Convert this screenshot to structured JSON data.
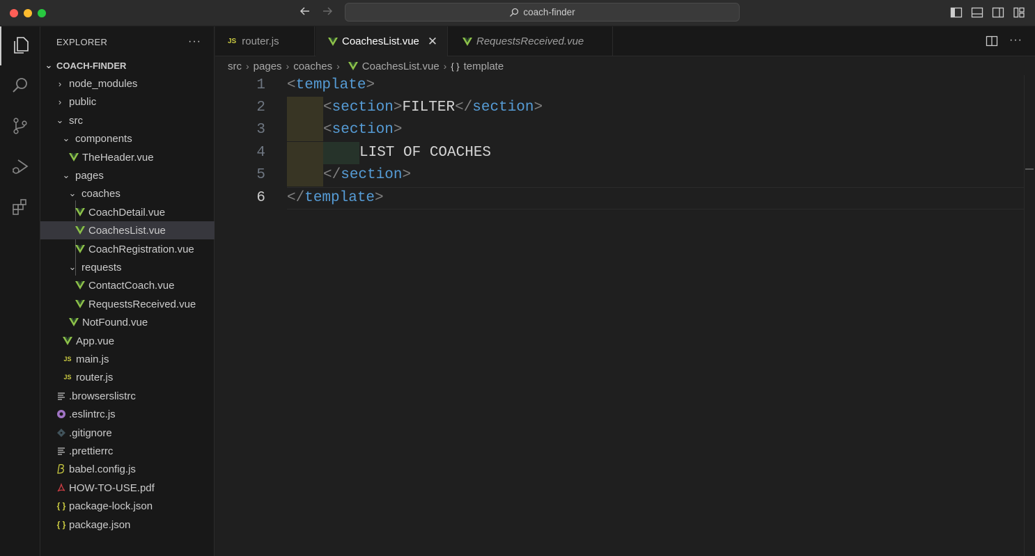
{
  "window": {
    "search_text": "coach-finder"
  },
  "sidebar": {
    "title": "EXPLORER",
    "more": "···",
    "tree": [
      {
        "label": "COACH-FINDER",
        "kind": "root"
      },
      {
        "label": "node_modules",
        "kind": "folder-collapsed"
      },
      {
        "label": "public",
        "kind": "folder-collapsed"
      },
      {
        "label": "src",
        "kind": "folder-open"
      },
      {
        "label": "components",
        "kind": "folder-open"
      },
      {
        "label": "TheHeader.vue",
        "kind": "vue"
      },
      {
        "label": "pages",
        "kind": "folder-open"
      },
      {
        "label": "coaches",
        "kind": "folder-open"
      },
      {
        "label": "CoachDetail.vue",
        "kind": "vue"
      },
      {
        "label": "CoachesList.vue",
        "kind": "vue",
        "selected": true
      },
      {
        "label": "CoachRegistration.vue",
        "kind": "vue"
      },
      {
        "label": "requests",
        "kind": "folder-open"
      },
      {
        "label": "ContactCoach.vue",
        "kind": "vue"
      },
      {
        "label": "RequestsReceived.vue",
        "kind": "vue"
      },
      {
        "label": "NotFound.vue",
        "kind": "vue"
      },
      {
        "label": "App.vue",
        "kind": "vue"
      },
      {
        "label": "main.js",
        "kind": "js"
      },
      {
        "label": "router.js",
        "kind": "js"
      },
      {
        "label": ".browserslistrc",
        "kind": "lines"
      },
      {
        "label": ".eslintrc.js",
        "kind": "eslint"
      },
      {
        "label": ".gitignore",
        "kind": "git"
      },
      {
        "label": ".prettierrc",
        "kind": "lines"
      },
      {
        "label": "babel.config.js",
        "kind": "babel"
      },
      {
        "label": "HOW-TO-USE.pdf",
        "kind": "pdf"
      },
      {
        "label": "package-lock.json",
        "kind": "json"
      },
      {
        "label": "package.json",
        "kind": "json"
      }
    ]
  },
  "icons": {
    "js_text": "JS",
    "json_text": "{ }"
  },
  "tabs": [
    {
      "label": "router.js",
      "kind": "js",
      "active": false
    },
    {
      "label": "CoachesList.vue",
      "kind": "vue",
      "active": true,
      "close": "✕"
    },
    {
      "label": "RequestsReceived.vue",
      "kind": "vue",
      "active": false,
      "italic": true
    }
  ],
  "breadcrumb": {
    "items": [
      "src",
      "pages",
      "coaches",
      "CoachesList.vue",
      "template"
    ],
    "symbol_glyph": "{ }"
  },
  "editor": {
    "line_numbers": [
      "1",
      "2",
      "3",
      "4",
      "5",
      "6"
    ],
    "current_line": "6",
    "lines": [
      {
        "open": "<",
        "name": "template",
        "close": ">"
      },
      {
        "open": "<",
        "name": "section",
        "close": ">",
        "text": "FILTER",
        "end_open": "</",
        "end_name": "section",
        "end_close": ">"
      },
      {
        "open": "<",
        "name": "section",
        "close": ">"
      },
      {
        "text": "LIST OF COACHES"
      },
      {
        "open": "</",
        "name": "section",
        "close": ">"
      },
      {
        "open": "</",
        "name": "template",
        "close": ">"
      }
    ]
  },
  "colors": {
    "vue": "#8dc149",
    "js": "#cbcb41",
    "json": "#cbcb41",
    "eslint": "#a074c4",
    "git": "#41535b",
    "pdf": "#cc3e44",
    "tag": "#569cd6",
    "bracket": "#808080"
  }
}
